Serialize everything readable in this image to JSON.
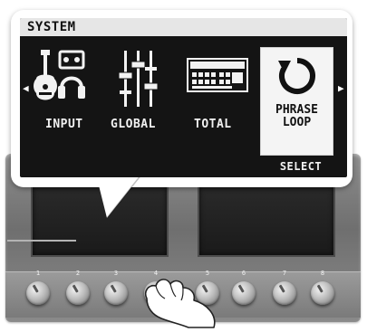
{
  "screen": {
    "title": "SYSTEM",
    "items": [
      {
        "label": "INPUT",
        "icon": "guitar-headphone-icon",
        "selected": false
      },
      {
        "label": "GLOBAL",
        "icon": "slider-icon",
        "selected": false
      },
      {
        "label": "TOTAL",
        "icon": "keyboard-device-icon",
        "selected": false
      },
      {
        "label_line1": "PHRASE",
        "label_line2": "LOOP",
        "icon": "loop-arrow-icon",
        "selected": true
      }
    ],
    "nav_left": "◀",
    "nav_right": "▶",
    "select_label": "SELECT"
  },
  "device": {
    "knob_labels": [
      "1",
      "2",
      "3",
      "4",
      "5",
      "6",
      "7",
      "8"
    ]
  },
  "colors": {
    "screen_bg": "#141414",
    "title_bar": "#e6e6e6",
    "panel": "#7f7f7f"
  }
}
